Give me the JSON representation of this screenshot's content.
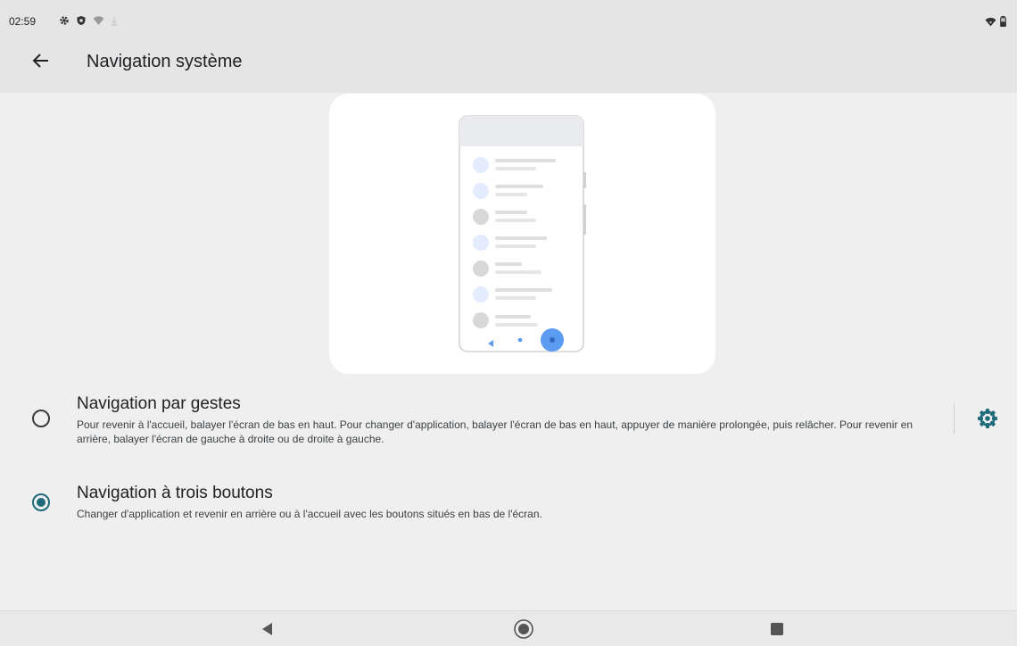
{
  "status_bar": {
    "time": "02:59",
    "left_icons": [
      "settings-icon",
      "shield-icon",
      "wifi-icon",
      "download-icon"
    ],
    "right_icons": [
      "wifi-icon",
      "battery-icon"
    ]
  },
  "app_bar": {
    "back_icon": "arrow-back-icon",
    "title": "Navigation système"
  },
  "options": {
    "gestures": {
      "title": "Navigation par gestes",
      "description": "Pour revenir à l'accueil, balayer l'écran de bas en haut. Pour changer d'application, balayer l'écran de bas en haut, appuyer de manière prolongée, puis relâcher. Pour revenir en arrière, balayer l'écran de gauche à droite ou de droite à gauche.",
      "selected": false,
      "settings_icon": "gear-icon"
    },
    "three_button": {
      "title": "Navigation à trois boutons",
      "description": "Changer d'application et revenir en arrière ou à l'accueil avec les boutons situés en bas de l'écran.",
      "selected": true
    }
  },
  "nav_bar": {
    "icons": [
      "nav-back-icon",
      "nav-home-icon",
      "nav-recents-icon"
    ]
  },
  "colors": {
    "accent": "#1f6b7a",
    "illustration_blue": "#5b9cf2",
    "illustration_light_blue": "#e3edfd"
  }
}
